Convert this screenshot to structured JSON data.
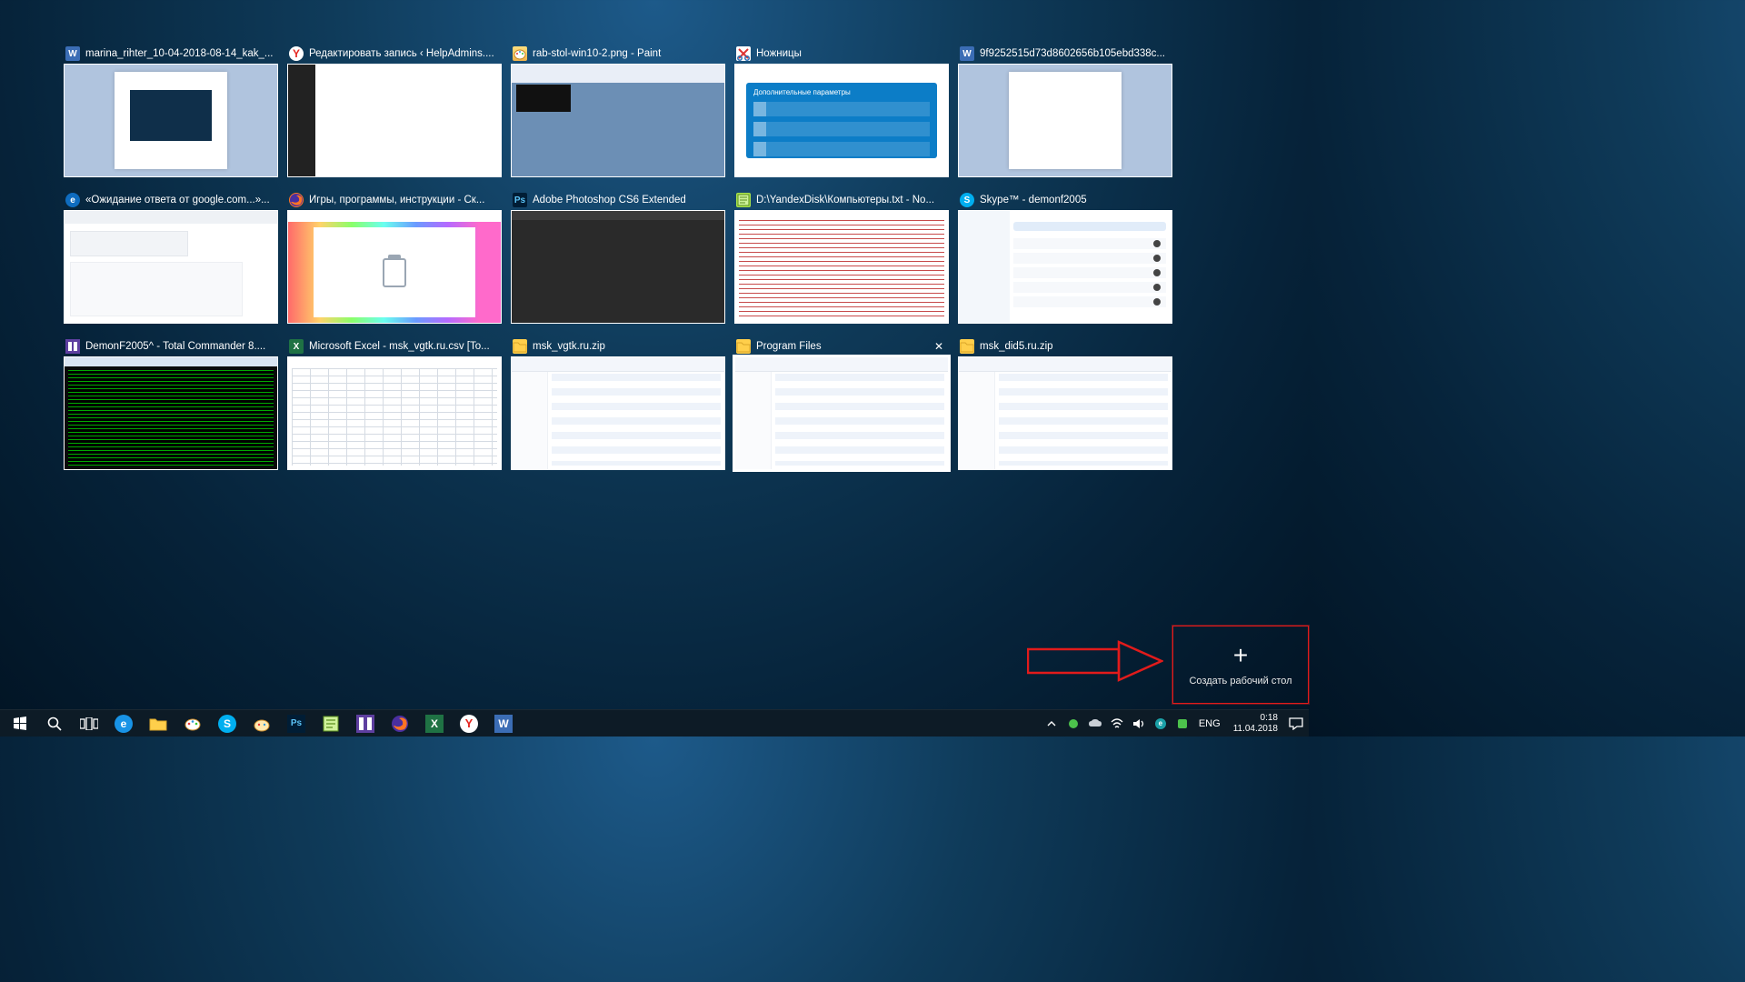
{
  "task_view": {
    "cards": [
      {
        "icon": "word",
        "title": "marina_rihter_10-04-2018-08-14_kak_...",
        "thumb": "word-embed",
        "selected": false
      },
      {
        "icon": "yandex",
        "title": "Редактировать запись ‹ HelpAdmins....",
        "thumb": "wp-admin",
        "selected": false
      },
      {
        "icon": "paint",
        "title": "rab-stol-win10-2.png - Paint",
        "thumb": "paint",
        "selected": false
      },
      {
        "icon": "snip",
        "title": "Ножницы",
        "thumb": "snip",
        "selected": false
      },
      {
        "icon": "word",
        "title": "9f9252515d73d8602656b105ebd338c...",
        "thumb": "word-blank",
        "selected": false
      },
      {
        "icon": "edge",
        "title": "«Ожидание ответа от google.com...»...",
        "thumb": "edge",
        "selected": false
      },
      {
        "icon": "ff",
        "title": "Игры, программы, инструкции - Ск...",
        "thumb": "ff",
        "selected": false
      },
      {
        "icon": "ps",
        "title": "Adobe Photoshop CS6 Extended",
        "thumb": "ps",
        "selected": false
      },
      {
        "icon": "npp",
        "title": "D:\\YandexDisk\\Компьютеры.txt - No...",
        "thumb": "npp",
        "selected": false
      },
      {
        "icon": "skype",
        "title": "Skype™ - demonf2005",
        "thumb": "skype",
        "selected": false
      },
      {
        "icon": "tc",
        "title": "DemonF2005^ - Total Commander 8....",
        "thumb": "tc",
        "selected": false
      },
      {
        "icon": "xl",
        "title": "Microsoft Excel - msk_vgtk.ru.csv  [To...",
        "thumb": "xl",
        "selected": false
      },
      {
        "icon": "folder",
        "title": "msk_vgtk.ru.zip",
        "thumb": "explorer",
        "selected": false
      },
      {
        "icon": "folder",
        "title": "Program Files",
        "thumb": "explorer",
        "selected": true,
        "show_close": true
      },
      {
        "icon": "folder",
        "title": "msk_did5.ru.zip",
        "thumb": "explorer",
        "selected": false
      }
    ]
  },
  "new_desktop_label": "Создать рабочий стол",
  "snip_tile_header": "Дополнительные параметры",
  "taskbar": {
    "apps": [
      {
        "name": "start",
        "icon": "win"
      },
      {
        "name": "search",
        "icon": "search"
      },
      {
        "name": "task-view",
        "icon": "taskview"
      },
      {
        "name": "edge",
        "icon": "edge"
      },
      {
        "name": "file-explorer",
        "icon": "folder"
      },
      {
        "name": "paint",
        "icon": "paint"
      },
      {
        "name": "skype",
        "icon": "skype"
      },
      {
        "name": "paint-alt",
        "icon": "paintb"
      },
      {
        "name": "photoshop",
        "icon": "ps"
      },
      {
        "name": "notepadpp",
        "icon": "npp"
      },
      {
        "name": "total-commander",
        "icon": "tc"
      },
      {
        "name": "firefox",
        "icon": "ff"
      },
      {
        "name": "excel",
        "icon": "xl"
      },
      {
        "name": "yandex",
        "icon": "yandex"
      },
      {
        "name": "word",
        "icon": "word"
      }
    ],
    "tray": {
      "lang": "ENG",
      "time": "0:18",
      "date": "11.04.2018"
    }
  }
}
